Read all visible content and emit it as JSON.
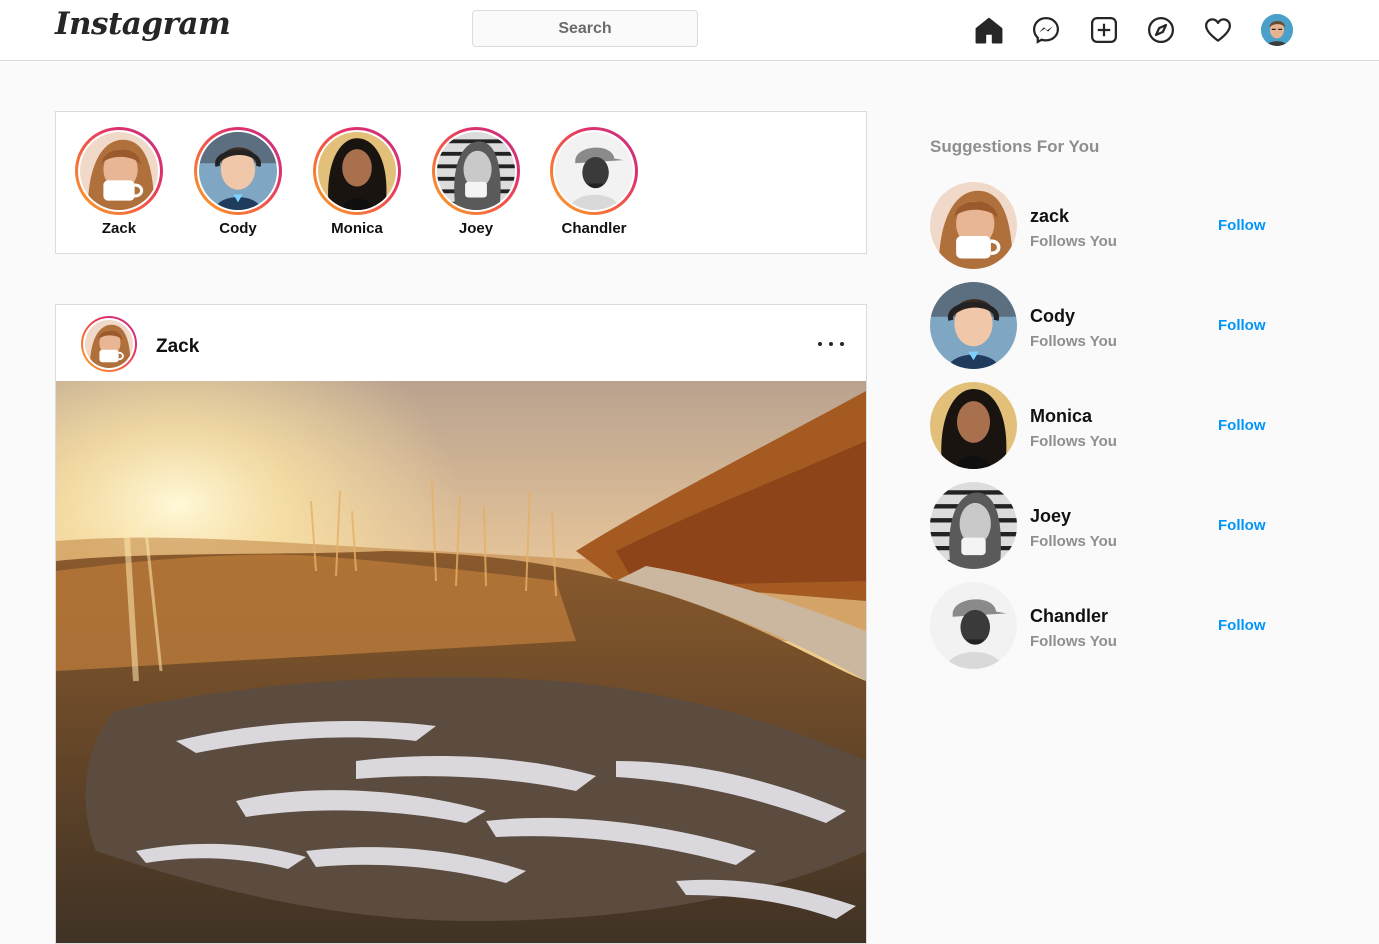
{
  "app": {
    "logo_text": "Instagram"
  },
  "search": {
    "placeholder": "Search"
  },
  "nav": {
    "icons": [
      "home-icon",
      "messenger-icon",
      "new-post-icon",
      "explore-icon",
      "activity-heart-icon",
      "profile-avatar"
    ]
  },
  "stories": [
    {
      "name": "Zack"
    },
    {
      "name": "Cody"
    },
    {
      "name": "Monica"
    },
    {
      "name": "Joey"
    },
    {
      "name": "Chandler"
    }
  ],
  "post": {
    "username": "Zack",
    "more_icon": "more-options-icon"
  },
  "suggestions": {
    "title": "Suggestions For You",
    "items": [
      {
        "name": "zack",
        "subtitle": "Follows You",
        "action": "Follow"
      },
      {
        "name": "Cody",
        "subtitle": "Follows You",
        "action": "Follow"
      },
      {
        "name": "Monica",
        "subtitle": "Follows You",
        "action": "Follow"
      },
      {
        "name": "Joey",
        "subtitle": "Follows You",
        "action": "Follow"
      },
      {
        "name": "Chandler",
        "subtitle": "Follows You",
        "action": "Follow"
      }
    ]
  },
  "colors": {
    "accent_blue": "#0095f6",
    "ring_gradient": [
      "#f9a825",
      "#f56040",
      "#e1306c",
      "#c13584"
    ],
    "border": "#dbdbdb",
    "background": "#fafafa"
  }
}
